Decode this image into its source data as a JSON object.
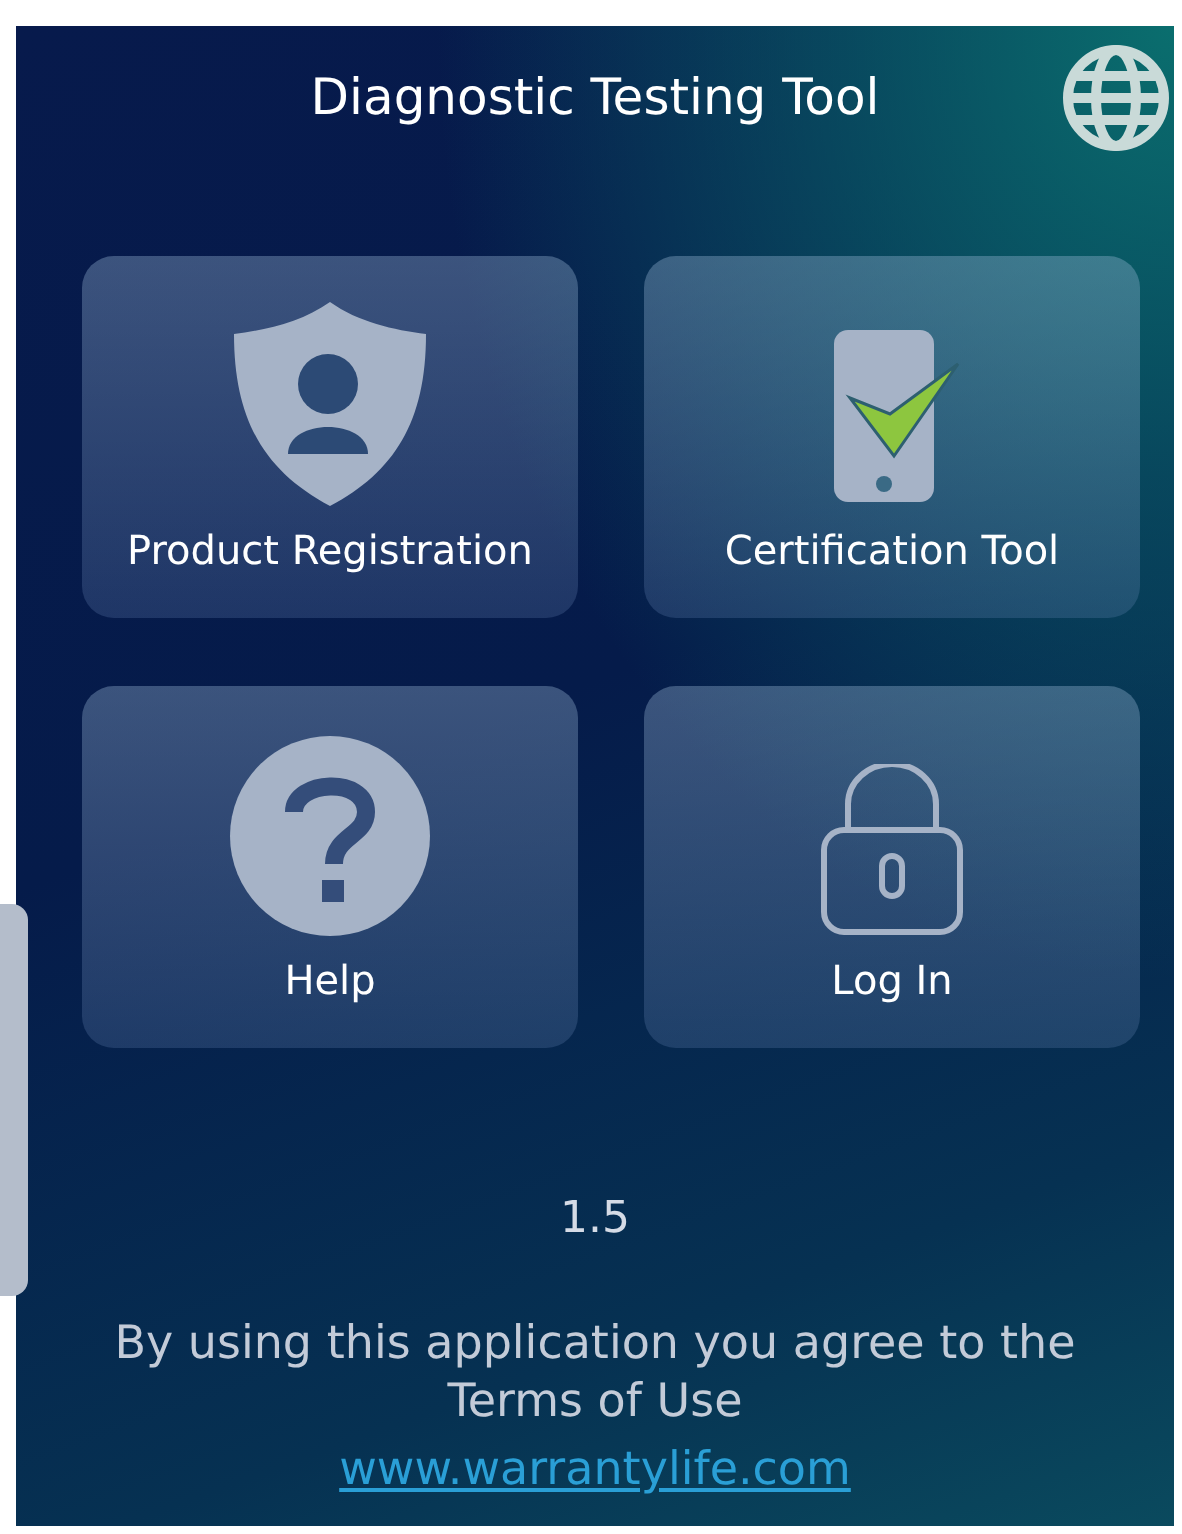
{
  "header": {
    "title": "Diagnostic Testing Tool"
  },
  "tiles": [
    {
      "label": "Product Registration",
      "kind": "shield"
    },
    {
      "label": "Certification Tool",
      "kind": "phone"
    },
    {
      "label": "Help",
      "kind": "help"
    },
    {
      "label": "Log In",
      "kind": "lock"
    }
  ],
  "version": "1.5",
  "terms": "By using this application you agree to the Terms of Use",
  "link": "www.warrantylife.com"
}
